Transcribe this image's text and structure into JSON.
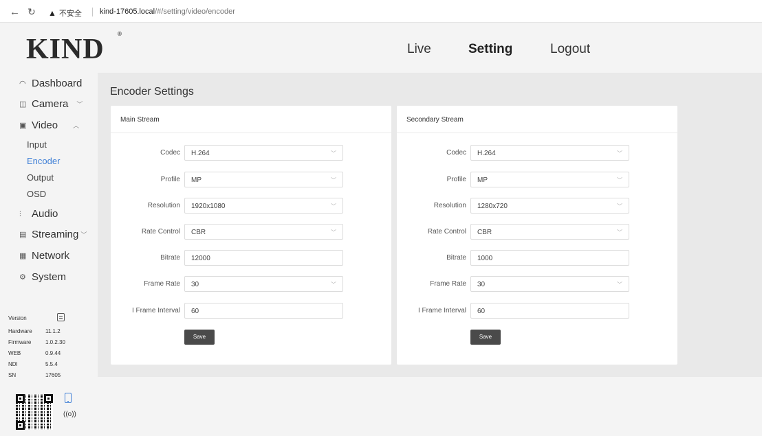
{
  "browser": {
    "security_label": "不安全",
    "url_host": "kind-17605.local",
    "url_path": "/#/setting/video/encoder"
  },
  "header": {
    "logo": "KIND",
    "logo_mark": "®",
    "nav": {
      "live": "Live",
      "setting": "Setting",
      "logout": "Logout"
    }
  },
  "sidebar": {
    "dashboard": "Dashboard",
    "camera": "Camera",
    "video": "Video",
    "video_sub": {
      "input": "Input",
      "encoder": "Encoder",
      "output": "Output",
      "osd": "OSD"
    },
    "audio": "Audio",
    "streaming": "Streaming",
    "network": "Network",
    "system": "System",
    "info": [
      {
        "label": "Version",
        "value": ""
      },
      {
        "label": "Hardware",
        "value": "11.1.2"
      },
      {
        "label": "Firmware",
        "value": "1.0.2.30"
      },
      {
        "label": "WEB",
        "value": "0.9.44"
      },
      {
        "label": "NDI",
        "value": "5.5.4"
      },
      {
        "label": "SN",
        "value": "17605"
      }
    ]
  },
  "page": {
    "title": "Encoder Settings"
  },
  "main_stream": {
    "title": "Main Stream",
    "codec_label": "Codec",
    "codec": "H.264",
    "profile_label": "Profile",
    "profile": "MP",
    "resolution_label": "Resolution",
    "resolution": "1920x1080",
    "rate_control_label": "Rate Control",
    "rate_control": "CBR",
    "bitrate_label": "Bitrate",
    "bitrate": "12000",
    "frame_rate_label": "Frame Rate",
    "frame_rate": "30",
    "iframe_label": "I Frame Interval",
    "iframe": "60",
    "save": "Save"
  },
  "secondary_stream": {
    "title": "Secondary Stream",
    "codec_label": "Codec",
    "codec": "H.264",
    "profile_label": "Profile",
    "profile": "MP",
    "resolution_label": "Resolution",
    "resolution": "1280x720",
    "rate_control_label": "Rate Control",
    "rate_control": "CBR",
    "bitrate_label": "Bitrate",
    "bitrate": "1000",
    "frame_rate_label": "Frame Rate",
    "frame_rate": "30",
    "iframe_label": "I Frame Interval",
    "iframe": "60",
    "save": "Save"
  },
  "colors": {
    "accent": "#3f7fd6",
    "button": "#4a4a4a",
    "panel": "#e9e9e9"
  }
}
